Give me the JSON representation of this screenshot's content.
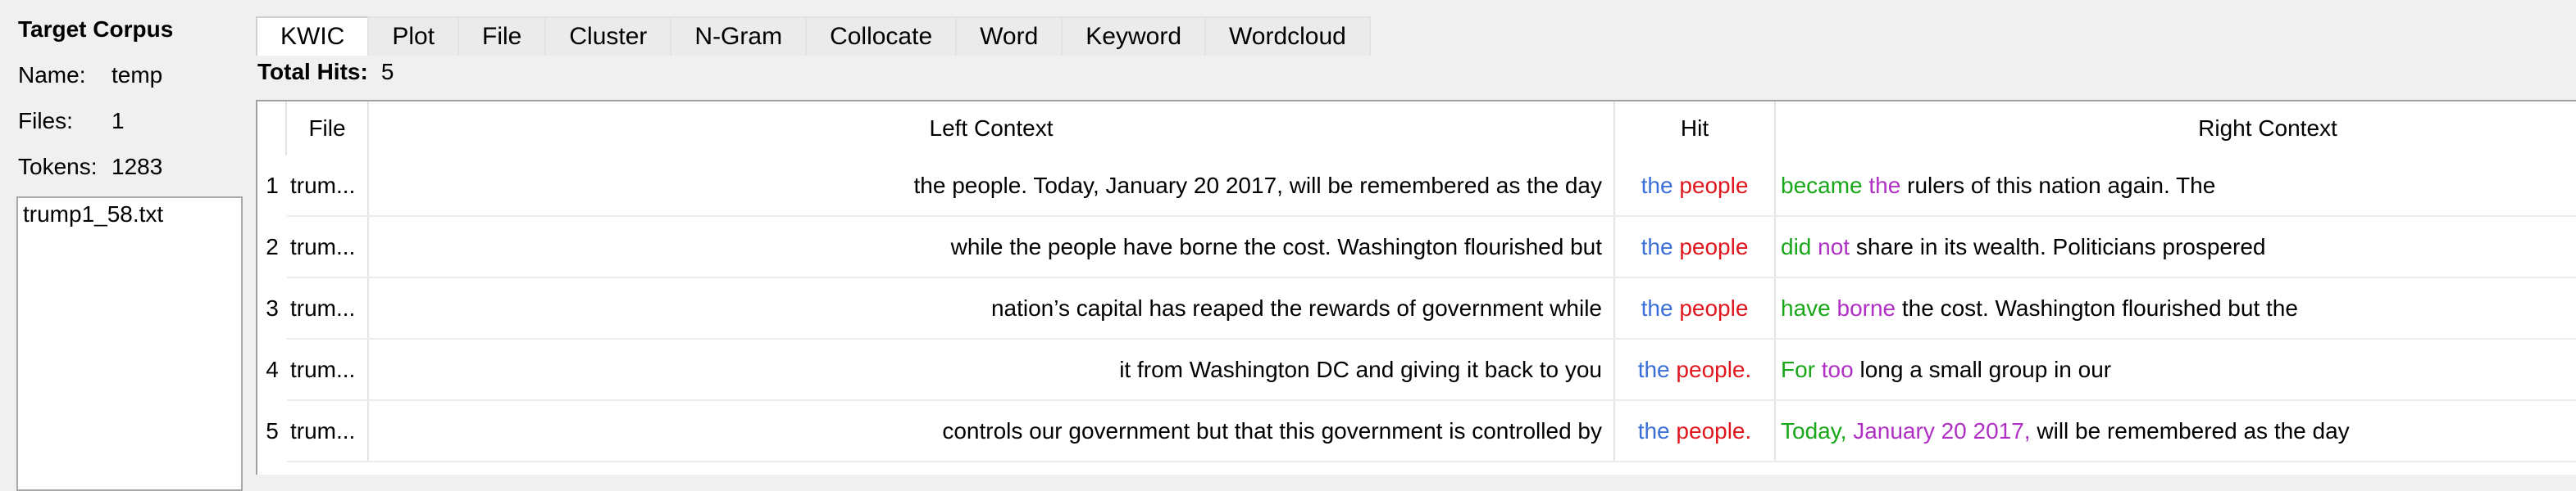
{
  "sidebar": {
    "title": "Target Corpus",
    "name_label": "Name:",
    "name_value": "temp",
    "files_label": "Files:",
    "files_value": "1",
    "tokens_label": "Tokens:",
    "tokens_value": "1283",
    "file_list": [
      "trump1_58.txt"
    ]
  },
  "tabs": [
    "KWIC",
    "Plot",
    "File",
    "Cluster",
    "N-Gram",
    "Collocate",
    "Word",
    "Keyword",
    "Wordcloud"
  ],
  "active_tab": "KWIC",
  "hits": {
    "label": "Total Hits:",
    "value": "5"
  },
  "table": {
    "headers": {
      "file": "File",
      "left": "Left Context",
      "hit": "Hit",
      "right": "Right Context"
    },
    "rows": [
      {
        "num": "1",
        "file": "trum...",
        "left": "the people. Today, January 20 2017, will be remembered as the day",
        "hit1": "the",
        "hit2": "people",
        "r1": "became",
        "r2": "the",
        "r3": "rulers of this nation again. The"
      },
      {
        "num": "2",
        "file": "trum...",
        "left": "while the people have borne the cost. Washington flourished but",
        "hit1": "the",
        "hit2": "people",
        "r1": "did",
        "r2": "not",
        "r3": "share in its wealth. Politicians prospered"
      },
      {
        "num": "3",
        "file": "trum...",
        "left": "nation’s capital has reaped the rewards of government while",
        "hit1": "the",
        "hit2": "people",
        "r1": "have",
        "r2": "borne",
        "r3": "the cost. Washington flourished but the"
      },
      {
        "num": "4",
        "file": "trum...",
        "left": "it from Washington DC and giving it back to you",
        "hit1": "the",
        "hit2": "people.",
        "r1": "For",
        "r2": "too",
        "r3": "long a small group in our"
      },
      {
        "num": "5",
        "file": "trum...",
        "left": "controls our government but that this government is controlled by",
        "hit1": "the",
        "hit2": "people.",
        "r1": "Today,",
        "r2": "January 20 2017,",
        "r3": "will be remembered as the day"
      }
    ]
  },
  "colors": {
    "hit_first": "#3a6fd8",
    "hit_second": "#e0161d",
    "right_first": "#18a718",
    "right_second": "#b02fc4"
  }
}
